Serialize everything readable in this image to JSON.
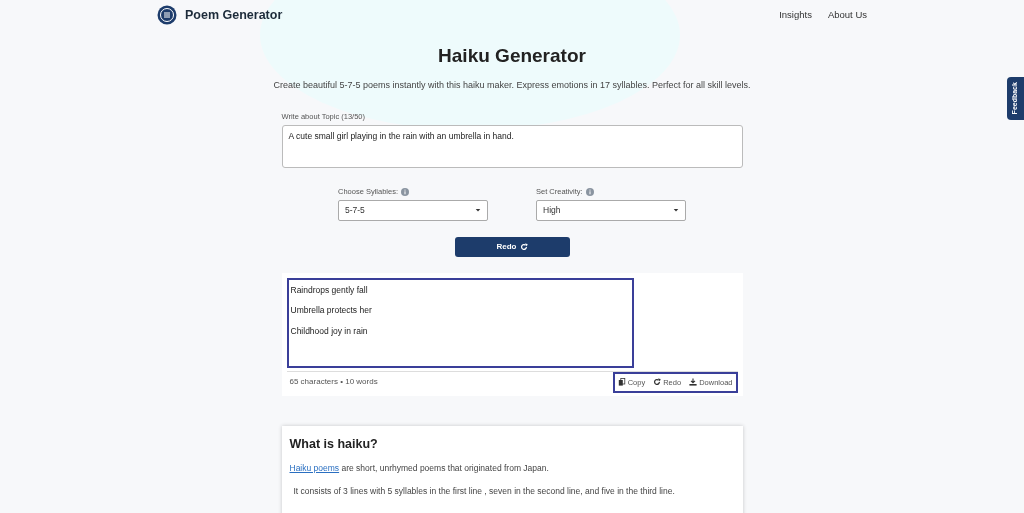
{
  "navbar": {
    "brand": "Poem Generator",
    "links": [
      "Insights",
      "About Us"
    ]
  },
  "header": {
    "title": "Haiku Generator",
    "subtitle": "Create beautiful 5-7-5 poems instantly with this haiku maker. Express emotions in 17 syllables. Perfect for all skill levels."
  },
  "topic": {
    "label": "Write about Topic (13/50)",
    "value": "A cute small girl playing in the rain with an umbrella in hand."
  },
  "selects": [
    {
      "label": "Choose Syllables:",
      "value": "5-7-5"
    },
    {
      "label": "Set Creativity:",
      "value": "High"
    }
  ],
  "generate_button": "Redo",
  "output": {
    "lines": [
      "Raindrops gently fall",
      "Umbrella protects her",
      "Childhood joy in rain"
    ],
    "stats": "65 characters • 10 words",
    "actions": [
      {
        "kind": "copy",
        "label": "Copy"
      },
      {
        "kind": "redo",
        "label": "Redo"
      },
      {
        "kind": "download",
        "label": "Download"
      }
    ]
  },
  "info": {
    "heading": "What is haiku?",
    "link": "Haiku poems",
    "intro": " are short, unrhymed poems that originated from Japan.",
    "detail": "It consists of 3 lines with 5 syllables in the first line , seven in the second line, and five in the third line."
  },
  "feedback_tab": "Feedback"
}
